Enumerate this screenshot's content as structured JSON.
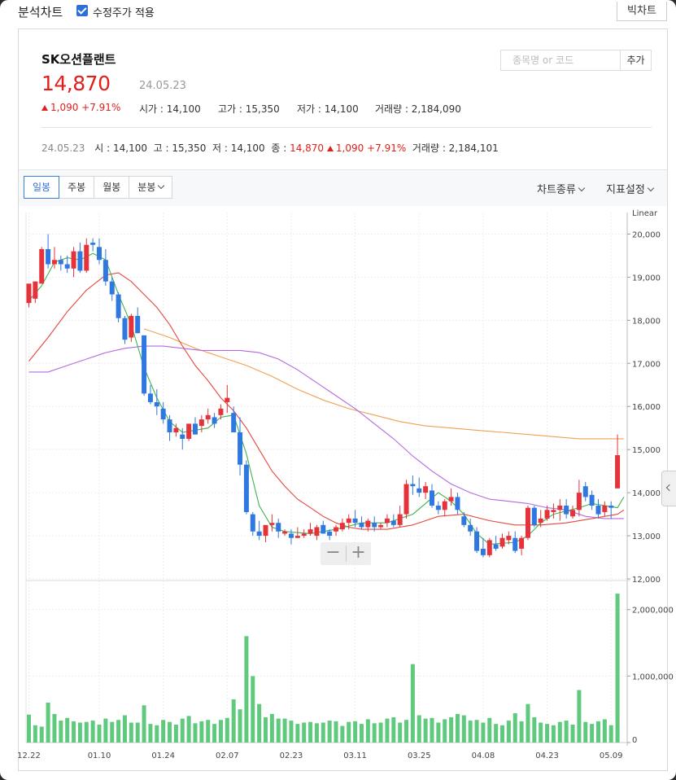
{
  "topbar": {
    "title": "분석차트",
    "checkbox_label": "수정주가 적용",
    "big_chart_button": "빅차트"
  },
  "stock": {
    "name": "SK오션플랜트",
    "price": "14,870",
    "date": "24.05.23",
    "change": "1,090 +7.91%",
    "open_label": "시가",
    "open": "14,100",
    "high_label": "고가",
    "high": "15,350",
    "low_label": "저가",
    "low": "14,100",
    "volume_label": "거래량",
    "volume": "2,184,090"
  },
  "search": {
    "placeholder": "종목명 or 코드",
    "add_label": "추가"
  },
  "ohlc_row": {
    "date": "24.05.23",
    "o_label": "시",
    "o": "14,100",
    "h_label": "고",
    "h": "15,350",
    "l_label": "저",
    "l": "14,100",
    "c_label": "종",
    "c": "14,870",
    "chg": "1,090 +7.91%",
    "v_label": "거래량",
    "v": "2,184,101"
  },
  "toolbar": {
    "tabs": [
      "일봉",
      "주봉",
      "월봉",
      "분봉"
    ],
    "active_tab": "일봉",
    "chart_type_menu": "차트종류",
    "indicator_menu": "지표설정"
  },
  "colors": {
    "up": "#e5333c",
    "down": "#2f78e0",
    "volume": "#5fca7d",
    "ma5": "#3cb450",
    "ma20": "#e5483a",
    "ma60": "#b36ae0",
    "ma120": "#f0a050"
  },
  "chart_data": {
    "type": "candlestick",
    "price_axis": {
      "scale_label": "Linear",
      "range": [
        12000,
        20500
      ],
      "ticks": [
        20000,
        19000,
        18000,
        17000,
        16000,
        15000,
        14000,
        13000,
        12000
      ],
      "tick_labels": [
        "20,000",
        "19,000",
        "18,000",
        "17,000",
        "16,000",
        "15,000",
        "14,000",
        "13,000",
        "12,000"
      ]
    },
    "volume_axis": {
      "range": [
        0,
        2400000
      ],
      "ticks": [
        0,
        1000000,
        2000000
      ],
      "tick_labels": [
        "0",
        "1,000,000",
        "2,000,000"
      ]
    },
    "x_labels": [
      {
        "index": 0,
        "label": "12.22"
      },
      {
        "index": 11,
        "label": "01.10"
      },
      {
        "index": 21,
        "label": "01.24"
      },
      {
        "index": 31,
        "label": "02.07"
      },
      {
        "index": 41,
        "label": "02.23"
      },
      {
        "index": 51,
        "label": "03.11"
      },
      {
        "index": 61,
        "label": "03.25"
      },
      {
        "index": 71,
        "label": "04.08"
      },
      {
        "index": 81,
        "label": "04.23"
      },
      {
        "index": 91,
        "label": "05.09"
      }
    ],
    "candles": [
      [
        18400,
        18850,
        18300,
        18850
      ],
      [
        18500,
        18900,
        18400,
        18900
      ],
      [
        18850,
        19700,
        18850,
        19650
      ],
      [
        19650,
        20000,
        19200,
        19300
      ],
      [
        19300,
        19700,
        19200,
        19400
      ],
      [
        19400,
        19500,
        19150,
        19300
      ],
      [
        19300,
        19500,
        19100,
        19200
      ],
      [
        19200,
        19700,
        19000,
        19600
      ],
      [
        19600,
        19800,
        19100,
        19150
      ],
      [
        19150,
        19900,
        19100,
        19750
      ],
      [
        19800,
        19900,
        19600,
        19750
      ],
      [
        19700,
        19900,
        19300,
        19400
      ],
      [
        19400,
        19650,
        18800,
        18900
      ],
      [
        18900,
        19000,
        18450,
        18600
      ],
      [
        18600,
        18650,
        17950,
        18050
      ],
      [
        18050,
        18100,
        17450,
        17550
      ],
      [
        17600,
        18150,
        17500,
        18100
      ],
      [
        18100,
        18300,
        17700,
        17700
      ],
      [
        17650,
        17650,
        16250,
        16300
      ],
      [
        16300,
        16500,
        16050,
        16100
      ],
      [
        16100,
        16400,
        15800,
        16000
      ],
      [
        15950,
        16100,
        15600,
        15700
      ],
      [
        15700,
        15800,
        15200,
        15400
      ],
      [
        15400,
        15600,
        15300,
        15500
      ],
      [
        15350,
        15500,
        15000,
        15250
      ],
      [
        15250,
        15600,
        15200,
        15600
      ],
      [
        15600,
        15750,
        15350,
        15350
      ],
      [
        15550,
        15800,
        15400,
        15700
      ],
      [
        15700,
        15950,
        15600,
        15800
      ],
      [
        15750,
        15850,
        15500,
        15600
      ],
      [
        15800,
        16050,
        15700,
        15950
      ],
      [
        16100,
        16500,
        15850,
        16200
      ],
      [
        15850,
        16000,
        15400,
        15400
      ],
      [
        15400,
        15750,
        14400,
        14650
      ],
      [
        14650,
        14750,
        13500,
        13550
      ],
      [
        13500,
        13550,
        13000,
        13100
      ],
      [
        13100,
        13350,
        12900,
        13000
      ],
      [
        13000,
        13200,
        12850,
        13250
      ],
      [
        13250,
        13500,
        13100,
        13300
      ],
      [
        13300,
        13400,
        12950,
        13100
      ],
      [
        13050,
        13150,
        13000,
        13100
      ],
      [
        13050,
        13150,
        12800,
        12950
      ],
      [
        12950,
        13200,
        12950,
        13000
      ],
      [
        13000,
        13150,
        12950,
        13050
      ],
      [
        13050,
        13300,
        13000,
        13150
      ],
      [
        13000,
        13250,
        12900,
        13200
      ],
      [
        13250,
        13350,
        13050,
        13050
      ],
      [
        13100,
        13150,
        12900,
        13000
      ],
      [
        13100,
        13250,
        13000,
        13200
      ],
      [
        13150,
        13400,
        13100,
        13300
      ],
      [
        13300,
        13500,
        13150,
        13400
      ],
      [
        13400,
        13600,
        13200,
        13300
      ],
      [
        13300,
        13450,
        13150,
        13200
      ],
      [
        13200,
        13400,
        13100,
        13350
      ],
      [
        13300,
        13450,
        13100,
        13200
      ],
      [
        13200,
        13300,
        13150,
        13250
      ],
      [
        13300,
        13500,
        13200,
        13400
      ],
      [
        13350,
        13500,
        13200,
        13250
      ],
      [
        13250,
        13700,
        13200,
        13500
      ],
      [
        13500,
        14300,
        13400,
        14200
      ],
      [
        14200,
        14400,
        13950,
        14150
      ],
      [
        14100,
        14350,
        13900,
        14000
      ],
      [
        14000,
        14250,
        13850,
        14150
      ],
      [
        14050,
        14200,
        13650,
        13700
      ],
      [
        13700,
        13800,
        13500,
        13600
      ],
      [
        13600,
        13850,
        13450,
        13800
      ],
      [
        13800,
        14100,
        13700,
        13900
      ],
      [
        13900,
        14000,
        13500,
        13600
      ],
      [
        13450,
        13550,
        13200,
        13250
      ],
      [
        13250,
        13400,
        13000,
        13100
      ],
      [
        13100,
        13200,
        12600,
        12650
      ],
      [
        12700,
        12950,
        12500,
        12550
      ],
      [
        12550,
        12950,
        12500,
        12900
      ],
      [
        12800,
        13000,
        12650,
        12700
      ],
      [
        12750,
        13050,
        12700,
        12950
      ],
      [
        12900,
        13100,
        12800,
        13000
      ],
      [
        12950,
        13100,
        12600,
        12650
      ],
      [
        12700,
        13000,
        12550,
        12950
      ],
      [
        12950,
        13700,
        12900,
        13650
      ],
      [
        13650,
        13700,
        13200,
        13250
      ],
      [
        13300,
        13600,
        13200,
        13400
      ],
      [
        13400,
        13700,
        13350,
        13600
      ],
      [
        13550,
        13750,
        13400,
        13600
      ],
      [
        13600,
        13850,
        13350,
        13700
      ],
      [
        13700,
        13850,
        13400,
        13500
      ],
      [
        13450,
        13700,
        13400,
        13600
      ],
      [
        13600,
        14300,
        13450,
        14000
      ],
      [
        14150,
        14250,
        13800,
        13900
      ],
      [
        13950,
        14050,
        13600,
        13700
      ],
      [
        13700,
        13850,
        13400,
        13500
      ],
      [
        13550,
        13800,
        13450,
        13700
      ],
      [
        13700,
        13800,
        13400,
        13650
      ],
      [
        14100,
        15350,
        14100,
        14870
      ]
    ],
    "volumes": [
      420000,
      260000,
      240000,
      600000,
      430000,
      330000,
      370000,
      320000,
      300000,
      310000,
      330000,
      270000,
      360000,
      310000,
      340000,
      410000,
      300000,
      300000,
      560000,
      280000,
      260000,
      340000,
      310000,
      270000,
      360000,
      400000,
      290000,
      320000,
      340000,
      280000,
      340000,
      370000,
      650000,
      500000,
      1600000,
      1000000,
      580000,
      380000,
      430000,
      360000,
      360000,
      330000,
      280000,
      300000,
      310000,
      290000,
      300000,
      330000,
      320000,
      250000,
      310000,
      320000,
      280000,
      350000,
      290000,
      300000,
      360000,
      380000,
      300000,
      340000,
      1180000,
      410000,
      360000,
      370000,
      300000,
      350000,
      380000,
      430000,
      410000,
      330000,
      340000,
      300000,
      370000,
      280000,
      260000,
      330000,
      440000,
      320000,
      580000,
      380000,
      300000,
      280000,
      260000,
      310000,
      330000,
      270000,
      790000,
      310000,
      280000,
      320000,
      350000,
      260000,
      2240000
    ],
    "ma5": [
      [
        0,
        18450
      ],
      [
        2,
        18800
      ],
      [
        4,
        19350
      ],
      [
        6,
        19450
      ],
      [
        8,
        19400
      ],
      [
        10,
        19550
      ],
      [
        12,
        19400
      ],
      [
        14,
        18600
      ],
      [
        16,
        17900
      ],
      [
        18,
        16900
      ],
      [
        20,
        16200
      ],
      [
        22,
        15650
      ],
      [
        24,
        15400
      ],
      [
        26,
        15450
      ],
      [
        28,
        15500
      ],
      [
        30,
        15750
      ],
      [
        32,
        15800
      ],
      [
        34,
        14900
      ],
      [
        36,
        13700
      ],
      [
        38,
        13200
      ],
      [
        40,
        13100
      ],
      [
        44,
        13050
      ],
      [
        48,
        13150
      ],
      [
        52,
        13300
      ],
      [
        56,
        13300
      ],
      [
        60,
        13500
      ],
      [
        64,
        14000
      ],
      [
        66,
        13800
      ],
      [
        68,
        13500
      ],
      [
        70,
        13050
      ],
      [
        72,
        12800
      ],
      [
        76,
        12850
      ],
      [
        78,
        13000
      ],
      [
        80,
        13300
      ],
      [
        82,
        13500
      ],
      [
        86,
        13650
      ],
      [
        88,
        13750
      ],
      [
        90,
        13700
      ],
      [
        92,
        13650
      ],
      [
        93,
        13900
      ]
    ],
    "ma20": [
      [
        0,
        17050
      ],
      [
        3,
        17600
      ],
      [
        6,
        18200
      ],
      [
        9,
        18700
      ],
      [
        12,
        19050
      ],
      [
        14,
        19100
      ],
      [
        16,
        18900
      ],
      [
        18,
        18600
      ],
      [
        20,
        18300
      ],
      [
        22,
        17900
      ],
      [
        24,
        17400
      ],
      [
        26,
        16950
      ],
      [
        28,
        16600
      ],
      [
        30,
        16200
      ],
      [
        32,
        15900
      ],
      [
        34,
        15500
      ],
      [
        36,
        15000
      ],
      [
        38,
        14500
      ],
      [
        40,
        14150
      ],
      [
        42,
        13850
      ],
      [
        44,
        13650
      ],
      [
        46,
        13450
      ],
      [
        48,
        13300
      ],
      [
        50,
        13200
      ],
      [
        52,
        13150
      ],
      [
        56,
        13150
      ],
      [
        60,
        13250
      ],
      [
        64,
        13450
      ],
      [
        68,
        13500
      ],
      [
        72,
        13350
      ],
      [
        76,
        13250
      ],
      [
        80,
        13250
      ],
      [
        84,
        13300
      ],
      [
        88,
        13400
      ],
      [
        92,
        13500
      ],
      [
        93,
        13600
      ]
    ],
    "ma60": [
      [
        0,
        16800
      ],
      [
        3,
        16800
      ],
      [
        6,
        16950
      ],
      [
        9,
        17100
      ],
      [
        12,
        17250
      ],
      [
        15,
        17350
      ],
      [
        18,
        17400
      ],
      [
        21,
        17400
      ],
      [
        24,
        17350
      ],
      [
        27,
        17300
      ],
      [
        30,
        17300
      ],
      [
        33,
        17300
      ],
      [
        36,
        17250
      ],
      [
        39,
        17100
      ],
      [
        42,
        16850
      ],
      [
        45,
        16550
      ],
      [
        48,
        16250
      ],
      [
        51,
        15950
      ],
      [
        54,
        15600
      ],
      [
        57,
        15250
      ],
      [
        60,
        14850
      ],
      [
        63,
        14500
      ],
      [
        66,
        14200
      ],
      [
        69,
        14000
      ],
      [
        72,
        13850
      ],
      [
        75,
        13800
      ],
      [
        78,
        13750
      ],
      [
        81,
        13650
      ],
      [
        84,
        13600
      ],
      [
        87,
        13450
      ],
      [
        90,
        13400
      ],
      [
        93,
        13400
      ]
    ],
    "ma120": [
      [
        18,
        17800
      ],
      [
        22,
        17600
      ],
      [
        26,
        17350
      ],
      [
        30,
        17150
      ],
      [
        34,
        16950
      ],
      [
        38,
        16700
      ],
      [
        42,
        16400
      ],
      [
        46,
        16150
      ],
      [
        50,
        15950
      ],
      [
        54,
        15800
      ],
      [
        58,
        15650
      ],
      [
        62,
        15550
      ],
      [
        66,
        15500
      ],
      [
        70,
        15450
      ],
      [
        74,
        15400
      ],
      [
        78,
        15350
      ],
      [
        82,
        15300
      ],
      [
        86,
        15250
      ],
      [
        90,
        15250
      ],
      [
        93,
        15250
      ]
    ]
  }
}
